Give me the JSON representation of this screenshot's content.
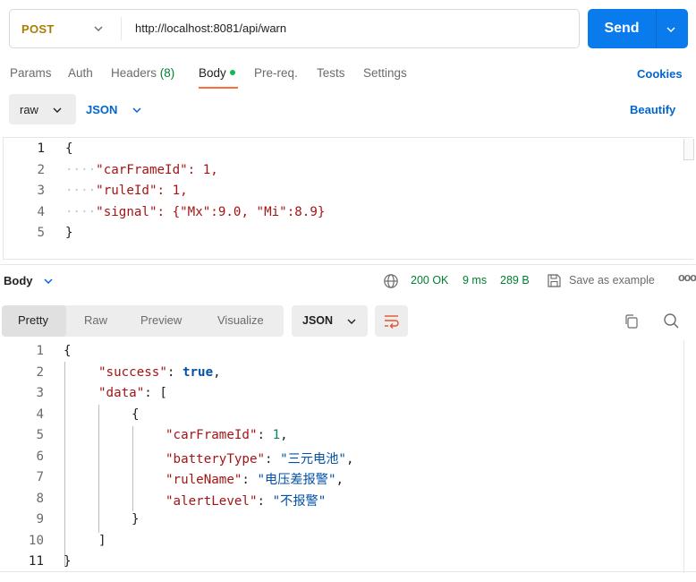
{
  "request": {
    "method": "POST",
    "url": "http://localhost:8081/api/warn",
    "send_label": "Send"
  },
  "tabs": {
    "params": "Params",
    "auth": "Auth",
    "headers": "Headers",
    "headers_count": "(8)",
    "body": "Body",
    "prereq": "Pre-req.",
    "tests": "Tests",
    "settings": "Settings",
    "cookies": "Cookies"
  },
  "body_options": {
    "mode": "raw",
    "language": "JSON",
    "beautify": "Beautify"
  },
  "request_body": {
    "line_numbers": [
      "1",
      "2",
      "3",
      "4",
      "5"
    ],
    "lines": [
      "{",
      "\"carFrameId\": 1,",
      "\"ruleId\": 1,",
      "\"signal\": {\"Mx\":9.0, \"Mi\":8.9}",
      "}"
    ]
  },
  "response": {
    "section_label": "Body",
    "status": "200 OK",
    "time": "9 ms",
    "size": "289 B",
    "save_example": "Save as example",
    "more": "ooo",
    "views": {
      "pretty": "Pretty",
      "raw": "Raw",
      "preview": "Preview",
      "visualize": "Visualize"
    },
    "format": "JSON",
    "line_numbers": [
      "1",
      "2",
      "3",
      "4",
      "5",
      "6",
      "7",
      "8",
      "9",
      "10",
      "11"
    ],
    "body": {
      "open_brace": "{",
      "success_key": "\"success\"",
      "success_value": "true",
      "data_key": "\"data\"",
      "open_bracket": "[",
      "obj_open": "{",
      "k_carFrameId": "\"carFrameId\"",
      "v_carFrameId": "1",
      "k_batteryType": "\"batteryType\"",
      "v_batteryType": "\"三元电池\"",
      "k_ruleName": "\"ruleName\"",
      "v_ruleName": "\"电压差报警\"",
      "k_alertLevel": "\"alertLevel\"",
      "v_alertLevel": "\"不报警\"",
      "obj_close": "}",
      "close_bracket": "]",
      "close_brace": "}"
    }
  },
  "icons": {
    "method_dropdown": "chevron-down-icon",
    "send_dropdown": "chevron-down-icon",
    "globe": "globe-icon",
    "save": "save-icon",
    "wrap": "wrap-lines-icon",
    "copy": "copy-icon",
    "search": "search-icon"
  },
  "colors": {
    "send_button": "#097bed",
    "method": "#ad7a03",
    "active_tab_underline": "#ff6c37",
    "status_ok": "#007f31",
    "link": "#0265d2"
  }
}
